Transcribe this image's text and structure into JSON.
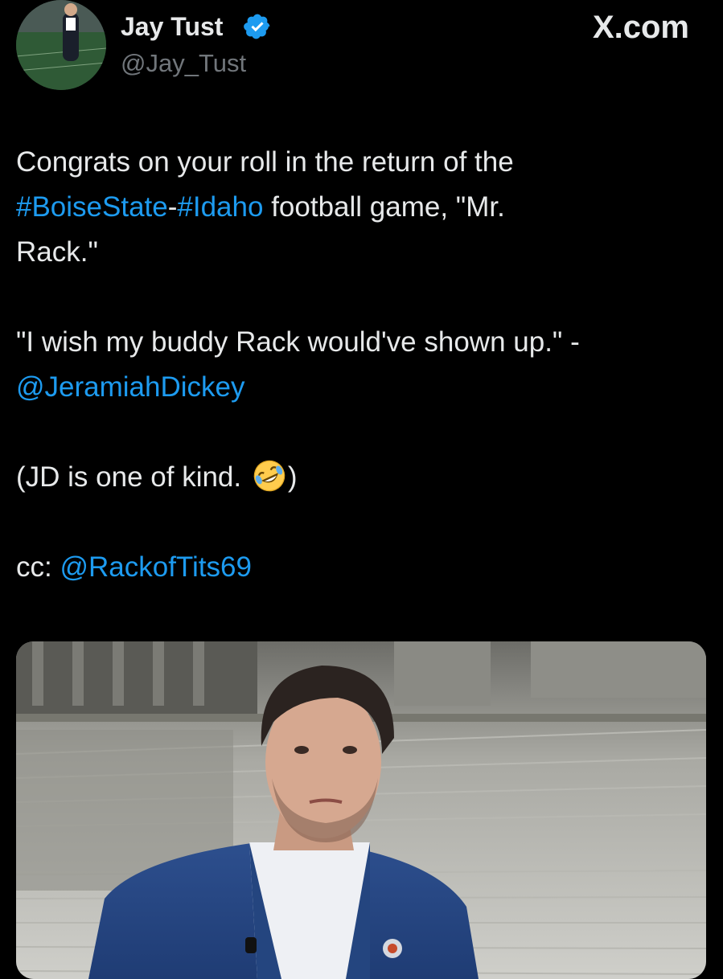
{
  "tweet": {
    "author": {
      "display_name": "Jay Tust",
      "handle": "@Jay_Tust",
      "verified": true,
      "avatar_icon": "profile-photo-stadium"
    },
    "brand": "X.com",
    "text": {
      "line1": "Congrats on your roll in the return of the",
      "hashtag1": "#BoiseState",
      "dash": "-",
      "hashtag2": "#Idaho",
      "line2_rest": " football game, \"Mr.",
      "line3": "Rack.\"",
      "quote": "\"I wish my buddy Rack would've shown up.\" -",
      "mention1": "@JeramiahDickey",
      "aside_start": "(JD is one of kind. ",
      "aside_emoji": "rolling-on-floor-laughing-emoji",
      "aside_end": ")",
      "cc_label": "cc: ",
      "mention2": "@RackofTits69"
    },
    "media": {
      "type": "photo",
      "description_icon": "photo-man-on-capitol-steps"
    }
  },
  "colors": {
    "background": "#000000",
    "text_primary": "#e7e9ea",
    "text_secondary": "#71767b",
    "link": "#1d9bf0",
    "verified_badge": "#1d9bf0"
  }
}
